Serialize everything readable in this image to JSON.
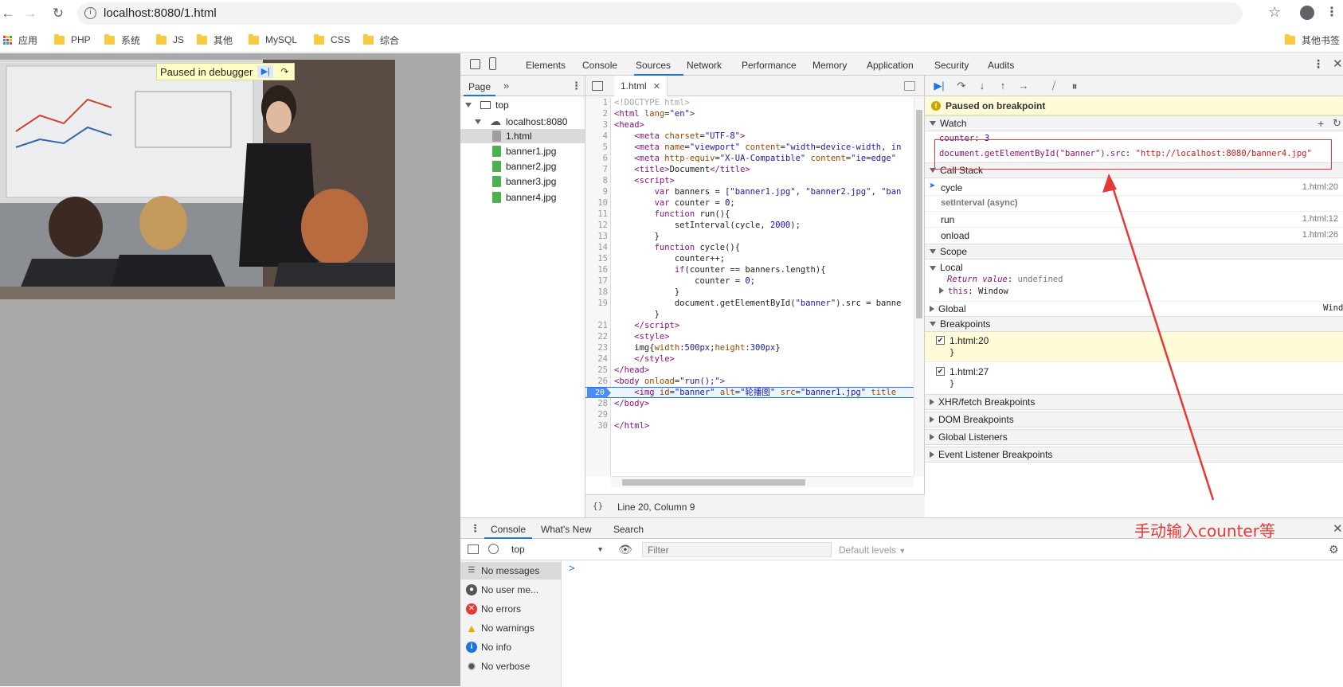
{
  "browser": {
    "url": "localhost:8080/1.html",
    "bookmarks": [
      "应用",
      "PHP",
      "系统",
      "JS",
      "其他",
      "MySQL",
      "CSS",
      "综合"
    ],
    "other_bookmarks": "其他书签"
  },
  "page": {
    "paused_label": "Paused in debugger"
  },
  "devtools": {
    "tabs": [
      "Elements",
      "Console",
      "Sources",
      "Network",
      "Performance",
      "Memory",
      "Application",
      "Security",
      "Audits"
    ],
    "navigator": {
      "tab": "Page",
      "tree": [
        "top",
        "localhost:8080",
        "1.html",
        "banner1.jpg",
        "banner2.jpg",
        "banner3.jpg",
        "banner4.jpg"
      ]
    },
    "editor": {
      "file_tab": "1.html",
      "status": "Line 20, Column 9",
      "line_numbers": [
        "1",
        "2",
        "3",
        "4",
        "5",
        "6",
        "7",
        "8",
        "9",
        "10",
        "11",
        "12",
        "13",
        "14",
        "15",
        "16",
        "17",
        "18",
        "19",
        "20",
        "21",
        "22",
        "23",
        "24",
        "25",
        "26",
        "27",
        "28",
        "29",
        "30"
      ]
    },
    "debugger": {
      "paused_msg": "Paused on breakpoint",
      "watch_title": "Watch",
      "watch": [
        {
          "expr": "counter",
          "value": "3"
        },
        {
          "expr": "document.getElementById(\"banner\").src",
          "value": "\"http://localhost:8080/banner4.jpg\""
        }
      ],
      "callstack_title": "Call Stack",
      "callstack": [
        {
          "fn": "cycle",
          "loc": "1.html:20"
        },
        {
          "fn": "setInterval (async)",
          "loc": ""
        },
        {
          "fn": "run",
          "loc": "1.html:12"
        },
        {
          "fn": "onload",
          "loc": "1.html:26"
        }
      ],
      "scope_title": "Scope",
      "scope_local": "Local",
      "return_value_key": "Return value",
      "return_value": "undefined",
      "this_key": "this",
      "this_value": "Window",
      "scope_global": "Global",
      "global_value": "Windo",
      "breakpoints_title": "Breakpoints",
      "breakpoints": [
        {
          "loc": "1.html:20",
          "code": "}"
        },
        {
          "loc": "1.html:27",
          "code": "}"
        }
      ],
      "sections": [
        "XHR/fetch Breakpoints",
        "DOM Breakpoints",
        "Global Listeners",
        "Event Listener Breakpoints"
      ]
    },
    "drawer": {
      "tabs": [
        "Console",
        "What's New",
        "Search"
      ],
      "context": "top",
      "filter_placeholder": "Filter",
      "levels": "Default levels",
      "sidebar": [
        "No messages",
        "No user me...",
        "No errors",
        "No warnings",
        "No info",
        "No verbose"
      ],
      "prompt": ">"
    }
  },
  "annotation": "手动输入counter等",
  "colors": {
    "accent": "#1a73e8",
    "annotation": "#e53935",
    "paused_bg": "#fffbd9"
  }
}
